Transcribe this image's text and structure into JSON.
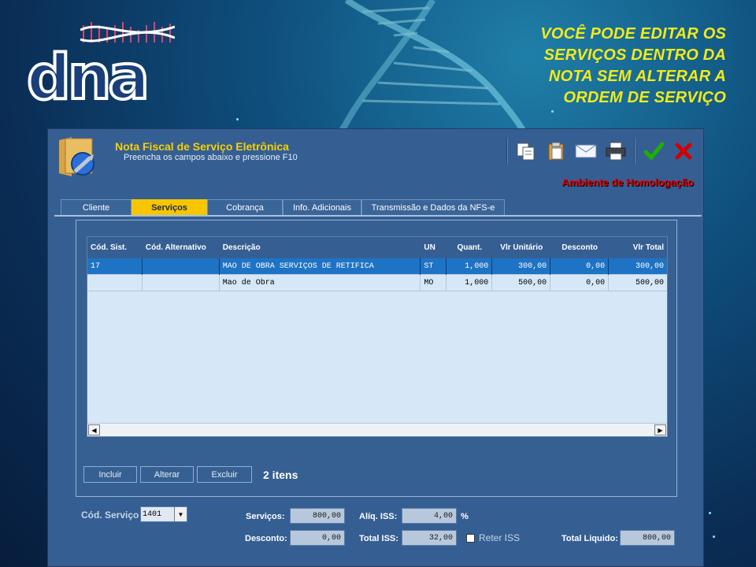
{
  "promo": {
    "line1": "VOCÊ PODE EDITAR OS",
    "line2": "SERVIÇOS DENTRO DA",
    "line3": "NOTA SEM ALTERAR A",
    "line4": "ORDEM DE SERVIÇO"
  },
  "logo": {
    "text": "dna"
  },
  "window": {
    "title": "Nota Fiscal de Serviço Eletrônica",
    "subtitle": "Preencha os campos abaixo e pressione F10",
    "environment": "Ambiente de Homologação"
  },
  "toolbar": {
    "icons": [
      "copy-icon",
      "paste-icon",
      "email-icon",
      "print-icon",
      "confirm-icon",
      "cancel-icon"
    ],
    "confirm_color": "#1db000",
    "cancel_color": "#d10000"
  },
  "tabs": [
    {
      "label": "Cliente",
      "active": false
    },
    {
      "label": "Serviços",
      "active": true
    },
    {
      "label": "Cobrança",
      "active": false
    },
    {
      "label": "Info. Adicionais",
      "active": false
    },
    {
      "label": "Transmissão e Dados da NFS-e",
      "active": false
    }
  ],
  "grid": {
    "columns": [
      "Cód. Sist.",
      "Cód. Alternativo",
      "Descrição",
      "UN",
      "Quant.",
      "Vlr Unitário",
      "Desconto",
      "Vlr Total"
    ],
    "rows": [
      {
        "cod_sist": "17",
        "cod_alt": "",
        "descricao": "MAO DE OBRA SERVIÇOS DE RETIFICA",
        "un": "ST",
        "quant": "1,000",
        "vlr_unit": "300,00",
        "desconto": "0,00",
        "vlr_total": "300,00",
        "selected": true
      },
      {
        "cod_sist": "",
        "cod_alt": "",
        "descricao": "Mao de Obra",
        "un": "MO",
        "quant": "1,000",
        "vlr_unit": "500,00",
        "desconto": "0,00",
        "vlr_total": "500,00",
        "selected": false
      }
    ]
  },
  "actions": {
    "incluir": "Incluir",
    "alterar": "Alterar",
    "excluir": "Excluir",
    "count": "2  itens"
  },
  "footer": {
    "cod_servico_label": "Cód. Serviço",
    "cod_servico_value": "1401",
    "servicos_label": "Serviços:",
    "servicos_value": "800,00",
    "desconto_label": "Desconto:",
    "desconto_value": "0,00",
    "aliq_iss_label": "Alíq. ISS:",
    "aliq_iss_value": "4,00",
    "percent": "%",
    "total_iss_label": "Total ISS:",
    "total_iss_value": "32,00",
    "reter_iss_label": "Reter ISS",
    "total_liquido_label": "Total Liquido:",
    "total_liquido_value": "800,00"
  }
}
